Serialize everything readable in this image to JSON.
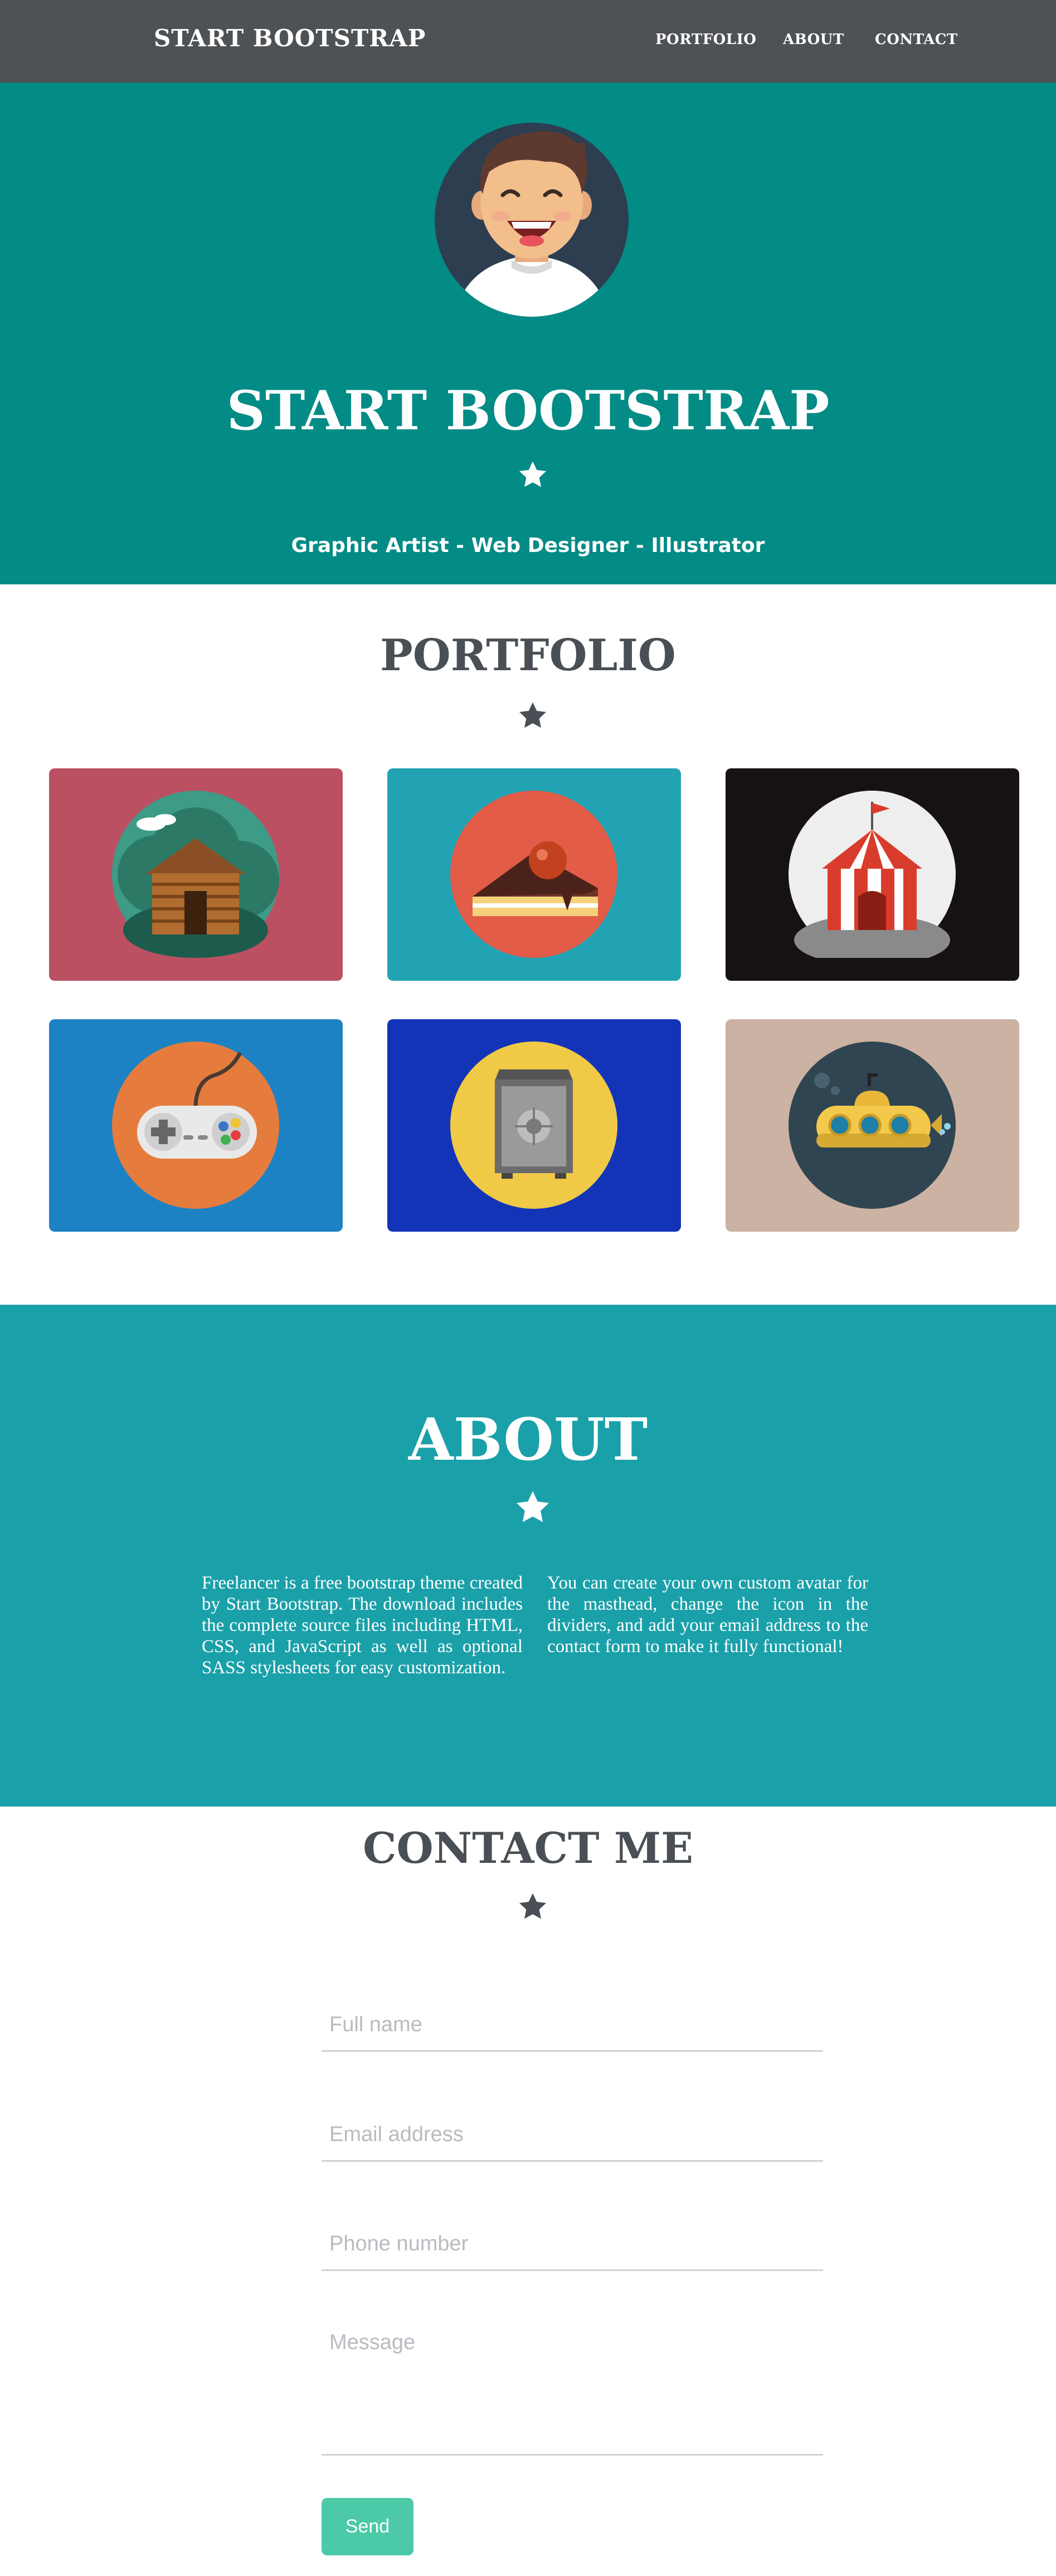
{
  "nav": {
    "brand": "START BOOTSTRAP",
    "links": [
      "PORTFOLIO",
      "ABOUT",
      "CONTACT"
    ]
  },
  "masthead": {
    "title": "START BOOTSTRAP",
    "subtitle": "Graphic Artist - Web Designer - Illustrator",
    "star_icon": "star-icon",
    "avatar_icon": "avatar-illustration"
  },
  "portfolio": {
    "title": "PORTFOLIO",
    "items": [
      {
        "name": "cabin",
        "bg": "#bb5063"
      },
      {
        "name": "cake",
        "bg": "#22a3b4"
      },
      {
        "name": "circus",
        "bg": "#171212"
      },
      {
        "name": "game",
        "bg": "#1d82c4"
      },
      {
        "name": "safe",
        "bg": "#1334b6"
      },
      {
        "name": "submarine",
        "bg": "#ccb2a3"
      }
    ]
  },
  "about": {
    "title": "ABOUT",
    "left": "Freelancer is a free bootstrap theme created by Start Bootstrap. The download includes the complete source files including HTML, CSS, and JavaScript as well as optional SASS stylesheets for easy customization.",
    "right": "You can create your own custom avatar for the masthead, change the icon in the dividers, and add your email address to the contact form to make it fully functional!"
  },
  "contact": {
    "title": "CONTACT ME",
    "fields": {
      "name": "Full name",
      "email": "Email address",
      "phone": "Phone number",
      "message": "Message"
    },
    "send": "Send"
  },
  "colors": {
    "nav_bg": "#4f5255",
    "primary": "#038b86",
    "about_bg": "#1aa0a9",
    "heading": "#4a4f55",
    "send": "#4cc9a6"
  }
}
